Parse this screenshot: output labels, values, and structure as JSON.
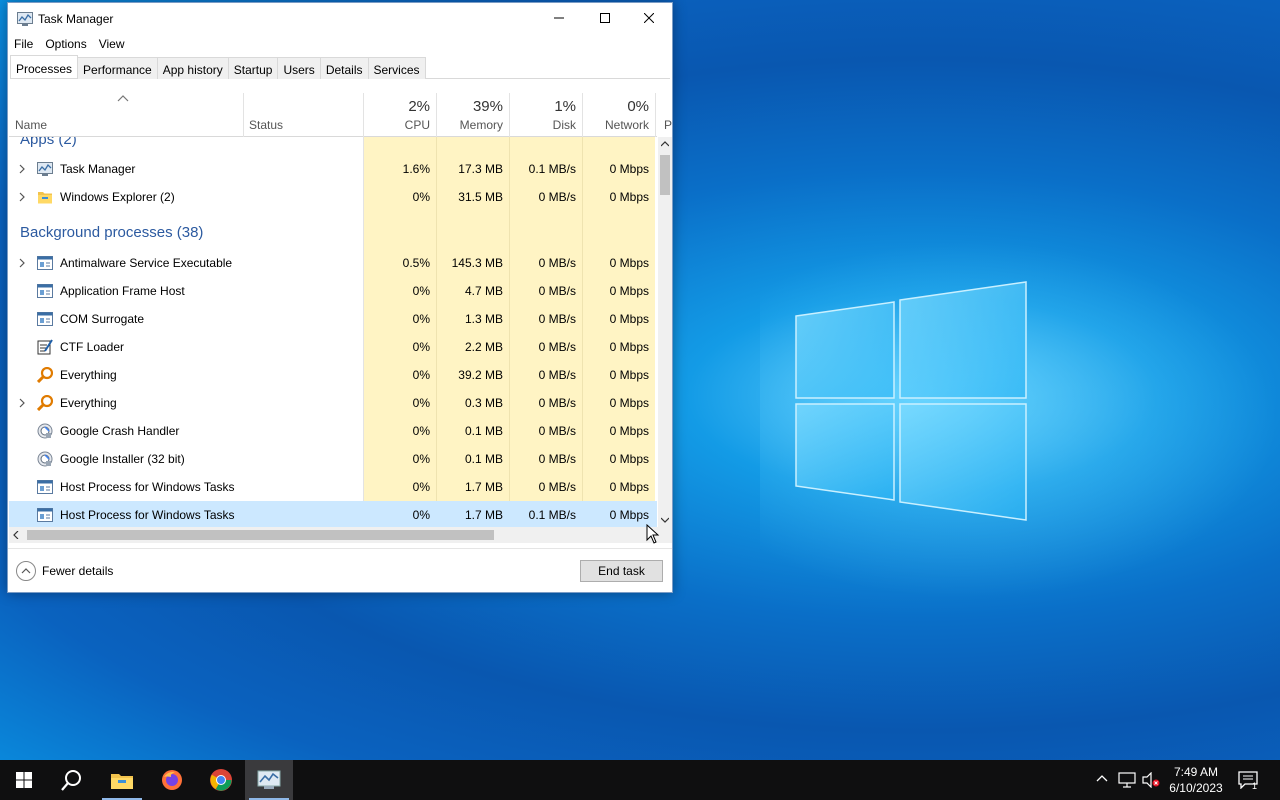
{
  "window": {
    "title": "Task Manager",
    "minimize": "—",
    "maximize": "☐",
    "close": "✕"
  },
  "menu": [
    "File",
    "Options",
    "View"
  ],
  "tabs": [
    "Processes",
    "Performance",
    "App history",
    "Startup",
    "Users",
    "Details",
    "Services"
  ],
  "active_tab": "Processes",
  "columns": {
    "name": "Name",
    "status": "Status",
    "cpu": {
      "pct": "2%",
      "label": "CPU"
    },
    "memory": {
      "pct": "39%",
      "label": "Memory"
    },
    "disk": {
      "pct": "1%",
      "label": "Disk"
    },
    "network": {
      "pct": "0%",
      "label": "Network"
    },
    "power": "P"
  },
  "groups": {
    "apps": "Apps (2)",
    "background": "Background processes (38)"
  },
  "rows": [
    {
      "name": "Task Manager",
      "icon": "task-manager-icon",
      "expandable": true,
      "cpu": "1.6%",
      "memory": "17.3 MB",
      "disk": "0.1 MB/s",
      "network": "0 Mbps"
    },
    {
      "name": "Windows Explorer (2)",
      "icon": "explorer-icon",
      "expandable": true,
      "cpu": "0%",
      "memory": "31.5 MB",
      "disk": "0 MB/s",
      "network": "0 Mbps"
    },
    {
      "name": "Antimalware Service Executable",
      "icon": "service-icon",
      "expandable": true,
      "cpu": "0.5%",
      "memory": "145.3 MB",
      "disk": "0 MB/s",
      "network": "0 Mbps"
    },
    {
      "name": "Application Frame Host",
      "icon": "service-icon",
      "expandable": false,
      "cpu": "0%",
      "memory": "4.7 MB",
      "disk": "0 MB/s",
      "network": "0 Mbps"
    },
    {
      "name": "COM Surrogate",
      "icon": "service-icon",
      "expandable": false,
      "cpu": "0%",
      "memory": "1.3 MB",
      "disk": "0 MB/s",
      "network": "0 Mbps"
    },
    {
      "name": "CTF Loader",
      "icon": "ctf-icon",
      "expandable": false,
      "cpu": "0%",
      "memory": "2.2 MB",
      "disk": "0 MB/s",
      "network": "0 Mbps"
    },
    {
      "name": "Everything",
      "icon": "search-magnifier-icon",
      "expandable": false,
      "cpu": "0%",
      "memory": "39.2 MB",
      "disk": "0 MB/s",
      "network": "0 Mbps"
    },
    {
      "name": "Everything",
      "icon": "search-magnifier-icon",
      "expandable": true,
      "cpu": "0%",
      "memory": "0.3 MB",
      "disk": "0 MB/s",
      "network": "0 Mbps"
    },
    {
      "name": "Google Crash Handler",
      "icon": "google-updater-icon",
      "expandable": false,
      "cpu": "0%",
      "memory": "0.1 MB",
      "disk": "0 MB/s",
      "network": "0 Mbps"
    },
    {
      "name": "Google Installer (32 bit)",
      "icon": "google-updater-icon",
      "expandable": false,
      "cpu": "0%",
      "memory": "0.1 MB",
      "disk": "0 MB/s",
      "network": "0 Mbps"
    },
    {
      "name": "Host Process for Windows Tasks",
      "icon": "service-icon",
      "expandable": false,
      "cpu": "0%",
      "memory": "1.7 MB",
      "disk": "0 MB/s",
      "network": "0 Mbps"
    },
    {
      "name": "Host Process for Windows Tasks",
      "icon": "service-icon",
      "expandable": false,
      "cpu": "0%",
      "memory": "1.7 MB",
      "disk": "0.1 MB/s",
      "network": "0 Mbps",
      "selected": true
    }
  ],
  "footer": {
    "fewer_details": "Fewer details",
    "end_task": "End task"
  },
  "taskbar": {
    "time": "7:49 AM",
    "date": "6/10/2023",
    "notification_count": "1",
    "apps": [
      "start-icon",
      "search-icon",
      "file-explorer-icon",
      "firefox-icon",
      "chrome-icon",
      "task-manager-icon"
    ]
  },
  "colors": {
    "cpu_heat": "#fff4c4",
    "mem_heat": "#fff4c4",
    "high_heat": "#ffeaa8",
    "selected_row": "#cce8ff",
    "group_text": "#2c5aa0"
  }
}
